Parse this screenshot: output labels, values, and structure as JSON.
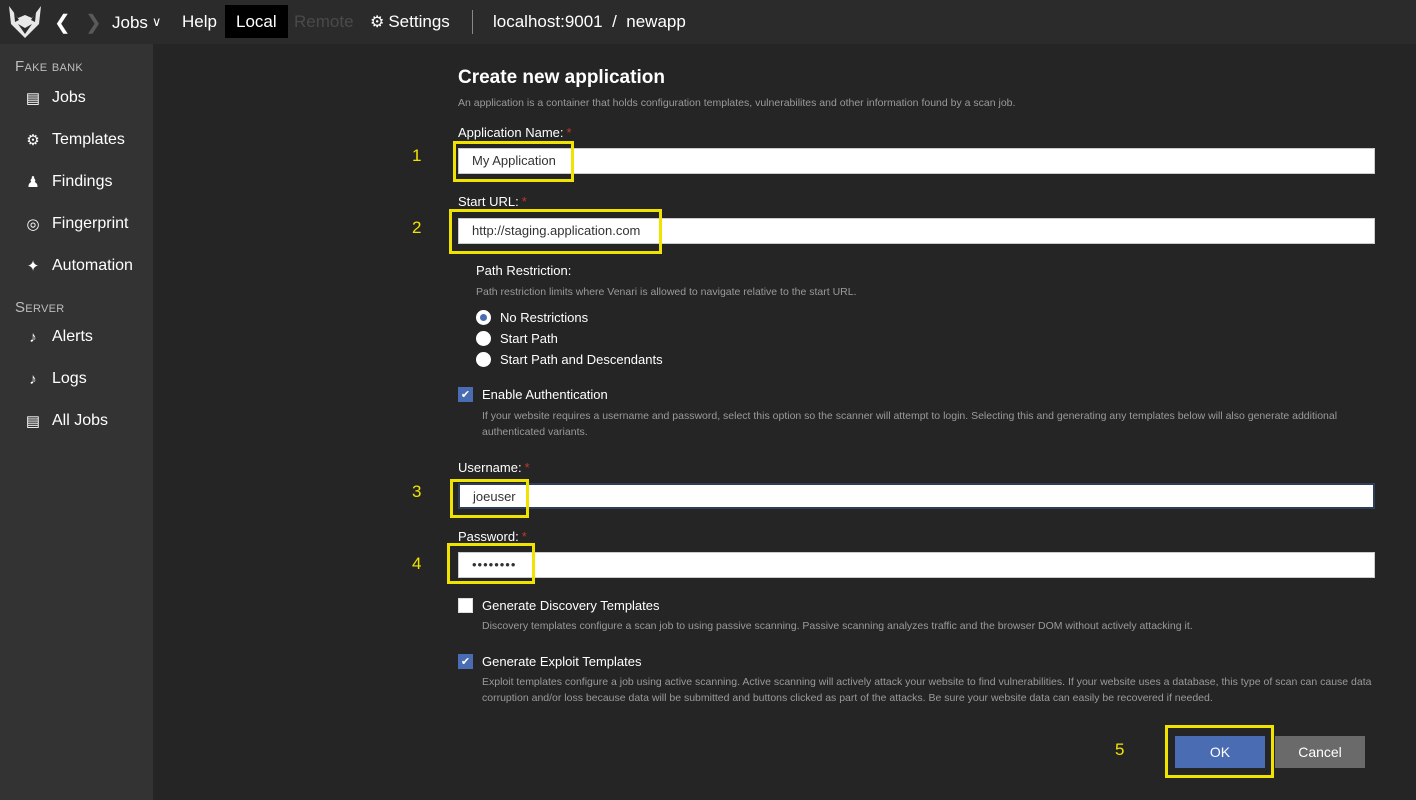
{
  "topbar": {
    "jobs": "Jobs",
    "help": "Help",
    "local": "Local",
    "remote": "Remote",
    "settings": "Settings",
    "path": "localhost:9001  /  newapp"
  },
  "sidebar": {
    "section1": "Fake bank",
    "section2": "Server",
    "items": [
      {
        "label": "Jobs",
        "icon": "briefcase-icon"
      },
      {
        "label": "Templates",
        "icon": "gears-icon"
      },
      {
        "label": "Findings",
        "icon": "spy-icon"
      },
      {
        "label": "Fingerprint",
        "icon": "fingerprint-icon"
      },
      {
        "label": "Automation",
        "icon": "magic-wand-icon"
      },
      {
        "label": "Alerts",
        "icon": "bell-icon"
      },
      {
        "label": "Logs",
        "icon": "bell-icon"
      },
      {
        "label": "All Jobs",
        "icon": "briefcase-icon"
      }
    ]
  },
  "form": {
    "title": "Create new application",
    "subtitle": "An application is a container that holds configuration templates, vulnerabilites and other information found by a scan job.",
    "app_name_label": "Application Name:",
    "app_name_value": "My Application",
    "start_url_label": "Start URL:",
    "start_url_value": "http://staging.application.com",
    "path_restriction_label": "Path Restriction:",
    "path_restriction_desc": "Path restriction limits where Venari is allowed to navigate relative to the start URL.",
    "radio_options": [
      "No Restrictions",
      "Start Path",
      "Start Path and Descendants"
    ],
    "selected_radio": "No Restrictions",
    "enable_auth_label": "Enable Authentication",
    "enable_auth_checked": true,
    "enable_auth_desc": "If your website requires a username and password, select this option so the scanner will attempt to login. Selecting this and generating any templates below will also generate additional authenticated variants.",
    "username_label": "Username:",
    "username_value": "joeuser",
    "password_label": "Password:",
    "password_value": "••••••••",
    "discovery_label": "Generate Discovery Templates",
    "discovery_checked": false,
    "discovery_desc": "Discovery templates configure a scan job to using passive scanning. Passive scanning analyzes traffic and the browser DOM without actively attacking it.",
    "exploit_label": "Generate Exploit Templates",
    "exploit_checked": true,
    "exploit_desc": "Exploit templates configure a job using active scanning. Active scanning will actively attack your website to find vulnerabilities. If your website uses a database, this type of scan can cause data corruption and/or loss because data will be submitted and buttons clicked as part of the attacks. Be sure your website data can easily be recovered if needed.",
    "ok_label": "OK",
    "cancel_label": "Cancel",
    "required_mark": "*"
  },
  "annotations": [
    "1",
    "2",
    "3",
    "4",
    "5"
  ],
  "colors": {
    "accent": "#4a6cb3",
    "annotation": "#f1e300",
    "required": "#c0392b"
  }
}
